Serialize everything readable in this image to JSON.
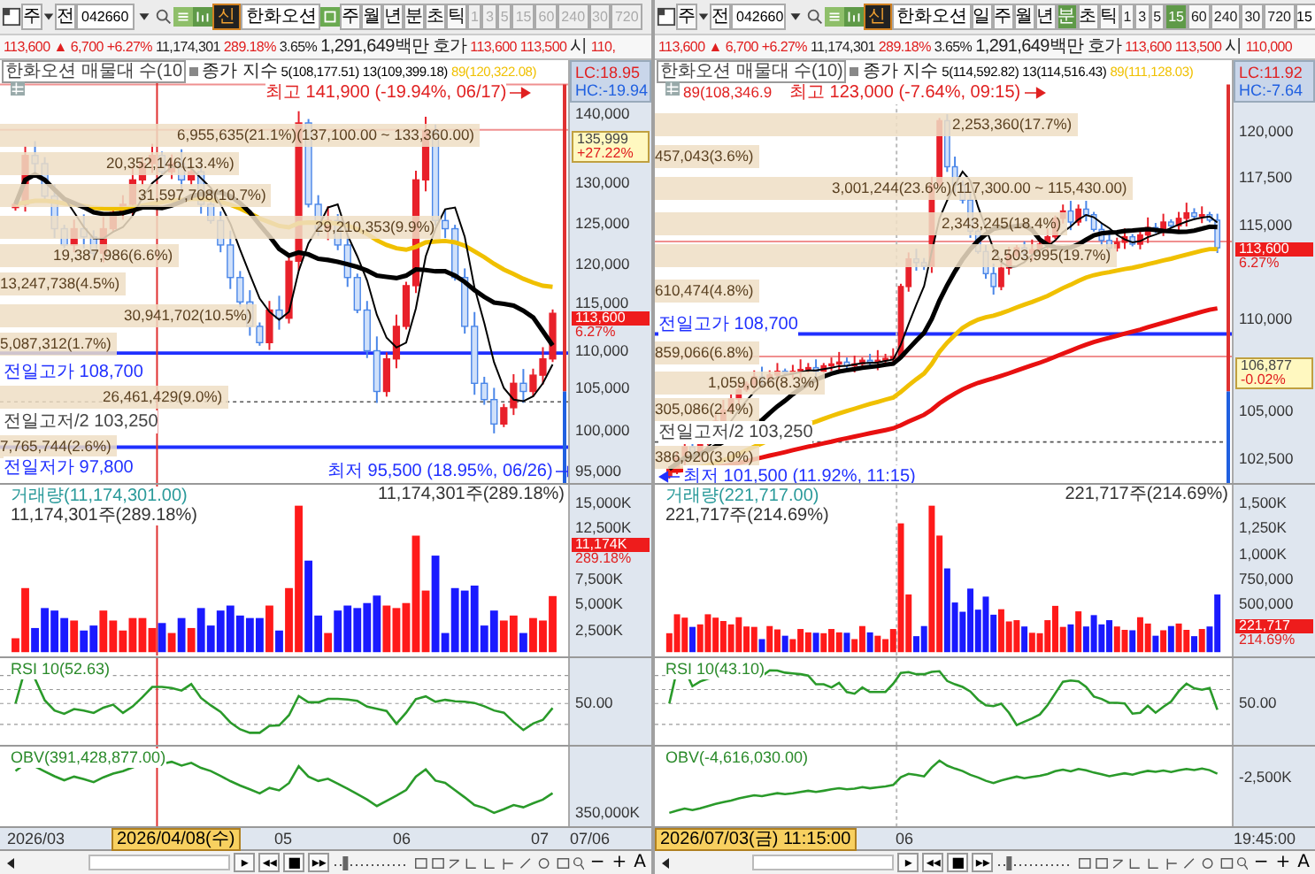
{
  "panes": [
    {
      "toolbar": {
        "market": "주",
        "type": "전",
        "code": "042660",
        "badge": "신",
        "name": "한화오션",
        "day_icon": true,
        "periods": [
          {
            "label": "주",
            "selected": false
          },
          {
            "label": "월",
            "selected": false
          },
          {
            "label": "년",
            "selected": false
          },
          {
            "label": "분",
            "selected": false
          },
          {
            "label": "초",
            "selected": false
          },
          {
            "label": "틱",
            "selected": false
          }
        ],
        "minutes": [
          {
            "label": "1",
            "selected": false,
            "disabled": true
          },
          {
            "label": "3",
            "selected": false,
            "disabled": true
          },
          {
            "label": "5",
            "selected": false,
            "disabled": true
          },
          {
            "label": "15",
            "selected": false,
            "disabled": true
          },
          {
            "label": "60",
            "selected": false,
            "disabled": true
          },
          {
            "label": "240",
            "selected": false,
            "disabled": true
          },
          {
            "label": "30",
            "selected": false,
            "disabled": true
          },
          {
            "label": "720",
            "selected": false,
            "disabled": true
          }
        ]
      },
      "quote": {
        "price": "113,600",
        "arrow": "▲",
        "change": "6,700",
        "change_pct": "+6.27%",
        "volume": "11,174,301",
        "volume_pct": "289.18%",
        "turnover": "3.65%",
        "amount": "1,291,649백만",
        "ask_label": "호가",
        "ask": "113,600",
        "bid": "113,500",
        "open_label": "시",
        "open": "110,"
      },
      "price_panel": {
        "title": "한화오션 매물대 수(10",
        "ma_label": "종가 지수",
        "ma": [
          {
            "text": "5(108,177.51)",
            "color": "#000000"
          },
          {
            "text": "13(109,399.18)",
            "color": "#000000"
          },
          {
            "text": "89(120,322.08)",
            "color": "#f0c000"
          }
        ],
        "lc": "LC:18.95",
        "hc": "HC:-19.94",
        "annotations": [
          {
            "kind": "high",
            "text": "최고 141,900 (-19.94%, 06/17)"
          },
          {
            "kind": "level",
            "text": "전일고가 108,700"
          },
          {
            "kind": "mid",
            "text": "전일고저/2 103,250"
          },
          {
            "kind": "level",
            "text": "전일저가 97,800"
          },
          {
            "kind": "low",
            "text": "최저 95,500 (18.95%, 06/26)"
          }
        ],
        "profile": [
          "6,955,635(21.1%)(137,100.00 ~ 133,360.00)",
          "20,352,146(13.4%)",
          "31,597,708(10.7%)",
          "29,210,353(9.9%)",
          "19,387,986(6.6%)",
          "13,247,738(4.5%)",
          "30,941,702(10.5%)",
          "5,087,312(1.7%)",
          "26,461,429(9.0%)",
          "7,765,744(2.6%)"
        ],
        "ticks": [
          "140,000",
          "130,000",
          "125,000",
          "120,000",
          "115,000",
          "110,000",
          "105,000",
          "100,000",
          "95,000"
        ],
        "tags": [
          {
            "kind": "mark",
            "price": "135,999",
            "pct": "+27.22%"
          },
          {
            "kind": "current",
            "price": "113,600",
            "pct": "6.27%"
          }
        ]
      },
      "volume_panel": {
        "title": "거래량(11,174,301.00)",
        "subtitle": "11,174,301주(289.18%)",
        "right_label": "11,174,301주(289.18%)",
        "ticks": [
          "15,000K",
          "12,500K",
          "7,500K",
          "5,000K",
          "2,500K"
        ],
        "tag": {
          "value": "11,174K",
          "pct": "289.18%"
        }
      },
      "rsi_panel": {
        "title": "RSI 10(52.63)",
        "tick": "50.00"
      },
      "obv_panel": {
        "title": "OBV(391,428,877.00)",
        "tick": "350,000K"
      },
      "x_axis": {
        "labels": [
          "2026/03",
          "05",
          "06",
          "07"
        ],
        "cursor": "2026/04/08(수)",
        "end": "07/06"
      },
      "bottom": {
        "nav": [
          "▸",
          "◂◂",
          "■",
          "▸▸"
        ],
        "slider": {
          "level": 0.12
        },
        "zoom": [
          "−",
          "+",
          "A"
        ]
      }
    },
    {
      "toolbar": {
        "market": "주",
        "type": "전",
        "code": "042660",
        "badge": "신",
        "name": "한화오션",
        "minute_input": "15",
        "periods": [
          {
            "label": "일",
            "selected": false
          },
          {
            "label": "주",
            "selected": false
          },
          {
            "label": "월",
            "selected": false
          },
          {
            "label": "년",
            "selected": false
          },
          {
            "label": "분",
            "selected": true
          },
          {
            "label": "초",
            "selected": false
          },
          {
            "label": "틱",
            "selected": false
          }
        ],
        "minutes": [
          {
            "label": "1",
            "selected": false,
            "disabled": false
          },
          {
            "label": "3",
            "selected": false,
            "disabled": false
          },
          {
            "label": "5",
            "selected": false,
            "disabled": false
          },
          {
            "label": "15",
            "selected": true,
            "disabled": false
          },
          {
            "label": "60",
            "selected": false,
            "disabled": false
          },
          {
            "label": "240",
            "selected": false,
            "disabled": false
          },
          {
            "label": "30",
            "selected": false,
            "disabled": false
          },
          {
            "label": "720",
            "selected": false,
            "disabled": false
          }
        ]
      },
      "quote": {
        "price": "113,600",
        "arrow": "▲",
        "change": "6,700",
        "change_pct": "+6.27%",
        "volume": "11,174,301",
        "volume_pct": "289.18%",
        "turnover": "3.65%",
        "amount": "1,291,649백만",
        "ask_label": "호가",
        "ask": "113,600",
        "bid": "113,500",
        "open_label": "시",
        "open": "110,000"
      },
      "price_panel": {
        "title": "한화오션 매물대 수(10)",
        "ma_label": "종가 지수",
        "ma": [
          {
            "text": "5(114,592.82)",
            "color": "#000000"
          },
          {
            "text": "13(114,516.43)",
            "color": "#000000"
          },
          {
            "text": "89(111,128.03)",
            "color": "#f0c000"
          }
        ],
        "lc": "LC:11.92",
        "hc": "HC:-7.64",
        "annotations": [
          {
            "kind": "text",
            "text": "89(108,346.9"
          },
          {
            "kind": "high",
            "text": "최고 123,000 (-7.64%, 09:15)"
          },
          {
            "kind": "level",
            "text": "전일고가 108,700"
          },
          {
            "kind": "mid",
            "text": "전일고저/2 103,250"
          },
          {
            "kind": "low",
            "text": "최저 101,500 (11.92%, 11:15)"
          }
        ],
        "profile": [
          "2,253,360(17.7%)",
          "457,043(3.6%)",
          "3,001,244(23.6%)(117,300.00 ~ 115,430.00)",
          "2,343,245(18.4%)",
          "2,503,995(19.7%)",
          "610,474(4.8%)",
          "859,066(6.8%)",
          "1,059,066(8.3%)",
          "305,086(2.4%)",
          "386,920(3.0%)"
        ],
        "ticks": [
          "120,000",
          "117,500",
          "115,000",
          "110,000",
          "105,000",
          "102,500"
        ],
        "tags": [
          {
            "kind": "current",
            "price": "113,600",
            "pct": "6.27%"
          },
          {
            "kind": "mark",
            "price": "106,877",
            "pct": "-0.02%"
          }
        ]
      },
      "volume_panel": {
        "title": "거래량(221,717.00)",
        "subtitle": "221,717주(214.69%)",
        "right_label": "221,717주(214.69%)",
        "ticks": [
          "1,500K",
          "1,250K",
          "1,000K",
          "750,000",
          "500,000"
        ],
        "tag": {
          "value": "221,717",
          "pct": "214.69%"
        }
      },
      "rsi_panel": {
        "title": "RSI 10(43.10)",
        "tick": "50.00"
      },
      "obv_panel": {
        "title": "OBV(-4,616,030.00)",
        "tick": "-2,500K"
      },
      "x_axis": {
        "labels": [
          "06"
        ],
        "cursor": "2026/07/03(금) 11:15:00",
        "end": "19:45:00"
      },
      "bottom": {
        "nav": [
          "▸",
          "◂◂",
          "■",
          "▸▸"
        ],
        "slider": {
          "level": 0.12
        },
        "zoom": [
          "−",
          "+",
          "A"
        ]
      }
    }
  ]
}
